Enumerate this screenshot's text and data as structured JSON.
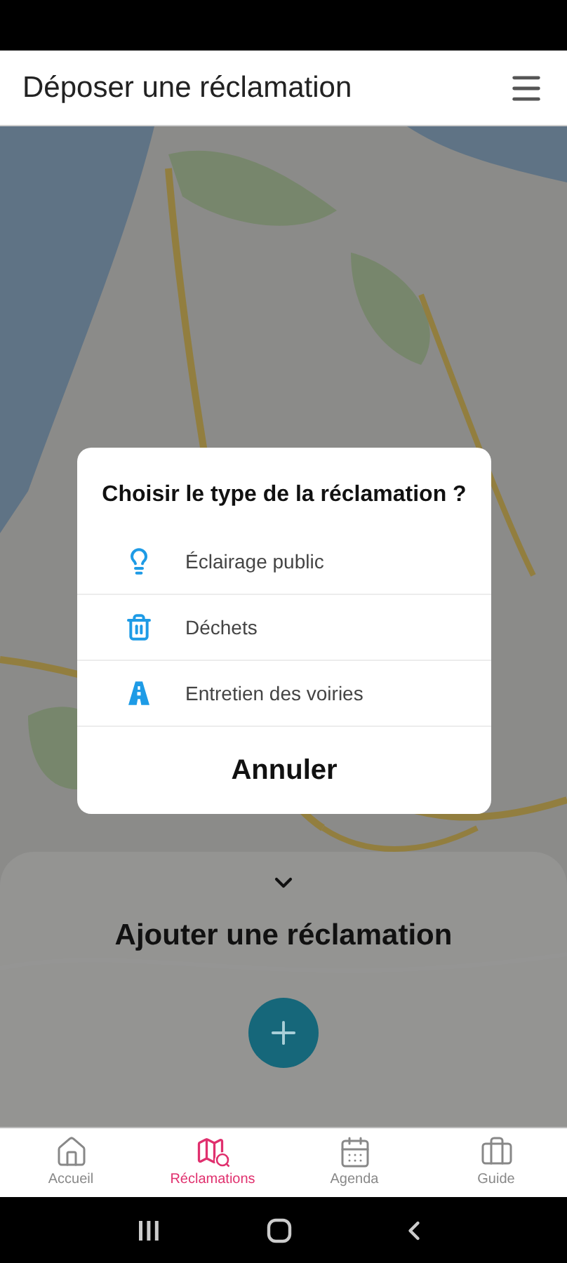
{
  "header": {
    "title": "Déposer une réclamation"
  },
  "dialog": {
    "title": "Choisir le type de la réclamation ?",
    "options": [
      {
        "kind": "lightbulb",
        "label": "Éclairage public"
      },
      {
        "kind": "trash",
        "label": "Déchets"
      },
      {
        "kind": "road",
        "label": "Entretien des voiries"
      }
    ],
    "cancel": "Annuler"
  },
  "sheet": {
    "title": "Ajouter une réclamation"
  },
  "tabs": [
    {
      "kind": "home",
      "label": "Accueil",
      "selected": false
    },
    {
      "kind": "map",
      "label": "Réclamations",
      "selected": true
    },
    {
      "kind": "calendar",
      "label": "Agenda",
      "selected": false
    },
    {
      "kind": "briefcase",
      "label": "Guide",
      "selected": false
    }
  ]
}
